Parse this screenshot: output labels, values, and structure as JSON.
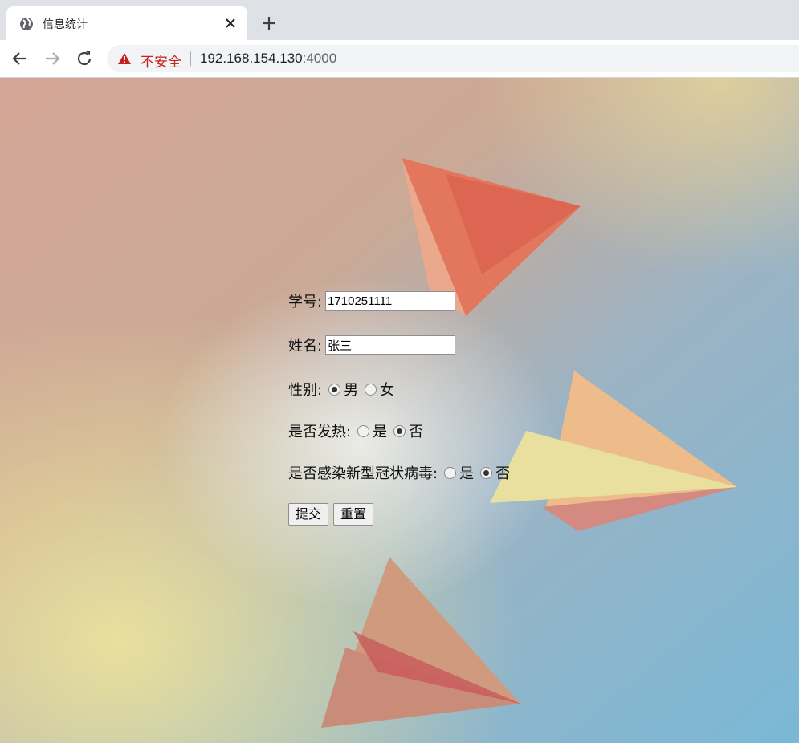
{
  "browser": {
    "tab_title": "信息统计",
    "insecure_label": "不安全",
    "separator": "|",
    "url_host": "192.168.154.130",
    "url_port": ":4000"
  },
  "form": {
    "student_id": {
      "label": "学号:",
      "value": "1710251111"
    },
    "name": {
      "label": "姓名:",
      "value": "张三"
    },
    "gender": {
      "label": "性别:",
      "options": [
        {
          "label": "男",
          "checked": true
        },
        {
          "label": "女",
          "checked": false
        }
      ]
    },
    "fever": {
      "label": "是否发热:",
      "options": [
        {
          "label": "是",
          "checked": false
        },
        {
          "label": "否",
          "checked": true
        }
      ]
    },
    "infected": {
      "label": "是否感染新型冠状病毒:",
      "options": [
        {
          "label": "是",
          "checked": false
        },
        {
          "label": "否",
          "checked": true
        }
      ]
    },
    "submit_label": "提交",
    "reset_label": "重置"
  },
  "colors": {
    "insecure": "#c5221f",
    "tab_bg": "#ffffff",
    "chrome_bg": "#dee1e6"
  }
}
